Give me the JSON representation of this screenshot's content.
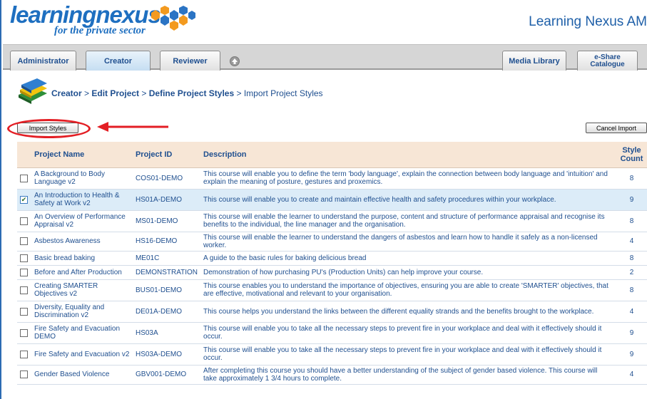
{
  "header": {
    "logo_text_1": "learning",
    "logo_text_2": "nexus",
    "logo_tagline": "for the private sector",
    "app_title": "Learning Nexus AM"
  },
  "tabs": {
    "administrator": "Administrator",
    "creator": "Creator",
    "reviewer": "Reviewer",
    "media_library": "Media Library",
    "eshare_line1": "e-Share",
    "eshare_line2": "Catalogue"
  },
  "breadcrumb": {
    "creator": "Creator",
    "sep": " > ",
    "edit_project": "Edit Project",
    "define_styles": "Define Project Styles",
    "current": "Import Project Styles"
  },
  "actions": {
    "import_styles": "Import Styles",
    "cancel_import": "Cancel Import"
  },
  "table": {
    "headers": {
      "name": "Project Name",
      "id": "Project ID",
      "description": "Description",
      "count_line1": "Style",
      "count_line2": "Count"
    },
    "rows": [
      {
        "name": "A Background to Body Language v2",
        "id": "COS01-DEMO",
        "description": "This course will enable you to define the term 'body language', explain the connection between body language and 'intuition' and explain the meaning of posture, gestures and proxemics.",
        "count": "8",
        "checked": false
      },
      {
        "name": "An Introduction to Health & Safety at Work v2",
        "id": "HS01A-DEMO",
        "description": "This course will enable you to create and maintain effective health and safety procedures within your workplace.",
        "count": "9",
        "checked": true
      },
      {
        "name": "An Overview of Performance Appraisal v2",
        "id": "MS01-DEMO",
        "description": "This course will enable the learner to understand the purpose, content and structure of performance appraisal and recognise its benefits to the individual, the line manager and the organisation.",
        "count": "8",
        "checked": false
      },
      {
        "name": "Asbestos Awareness",
        "id": "HS16-DEMO",
        "description": "This course will enable the learner to understand the dangers of asbestos and learn how to handle it safely as a non-licensed worker.",
        "count": "4",
        "checked": false
      },
      {
        "name": "Basic bread baking",
        "id": "ME01C",
        "description": "A guide to the basic rules for baking delicious bread",
        "count": "8",
        "checked": false
      },
      {
        "name": "Before and After Production",
        "id": "DEMONSTRATION",
        "description": "Demonstration of how purchasing PU's (Production Units) can help improve your course.",
        "count": "2",
        "checked": false
      },
      {
        "name": "Creating SMARTER Objectives v2",
        "id": "BUS01-DEMO",
        "description": "This course enables you to understand the importance of objectives, ensuring you are able to create 'SMARTER' objectives, that are effective, motivational and relevant to your organisation.",
        "count": "8",
        "checked": false
      },
      {
        "name": "Diversity, Equality and Discrimination v2",
        "id": "DE01A-DEMO",
        "description": "This course helps you understand the links between the different equality strands and the benefits brought to the workplace.",
        "count": "4",
        "checked": false
      },
      {
        "name": "Fire Safety and Evacuation DEMO",
        "id": "HS03A",
        "description": "This course will enable you to take all the necessary steps to prevent fire in your workplace and deal with it effectively should it occur.",
        "count": "9",
        "checked": false
      },
      {
        "name": "Fire Safety and Evacuation v2",
        "id": "HS03A-DEMO",
        "description": "This course will enable you to take all the necessary steps to prevent fire in your workplace and deal with it effectively should it occur.",
        "count": "9",
        "checked": false
      },
      {
        "name": "Gender Based Violence",
        "id": "GBV001-DEMO",
        "description": "After completing this course you should have a better understanding of the subject of gender based violence. This course will take approximately 1 3/4 hours to complete.",
        "count": "4",
        "checked": false
      }
    ]
  },
  "colors": {
    "accent": "#1e6fc0",
    "header_row": "#f7e6d6",
    "selected_row": "#dcecf8",
    "highlight": "#e31e24"
  },
  "icons": {
    "logo": "hexagon-cluster-icon",
    "up": "up-arrow-circle-icon",
    "books": "books-stack-icon",
    "pointer": "red-arrow-icon",
    "check": "checkmark-icon"
  }
}
